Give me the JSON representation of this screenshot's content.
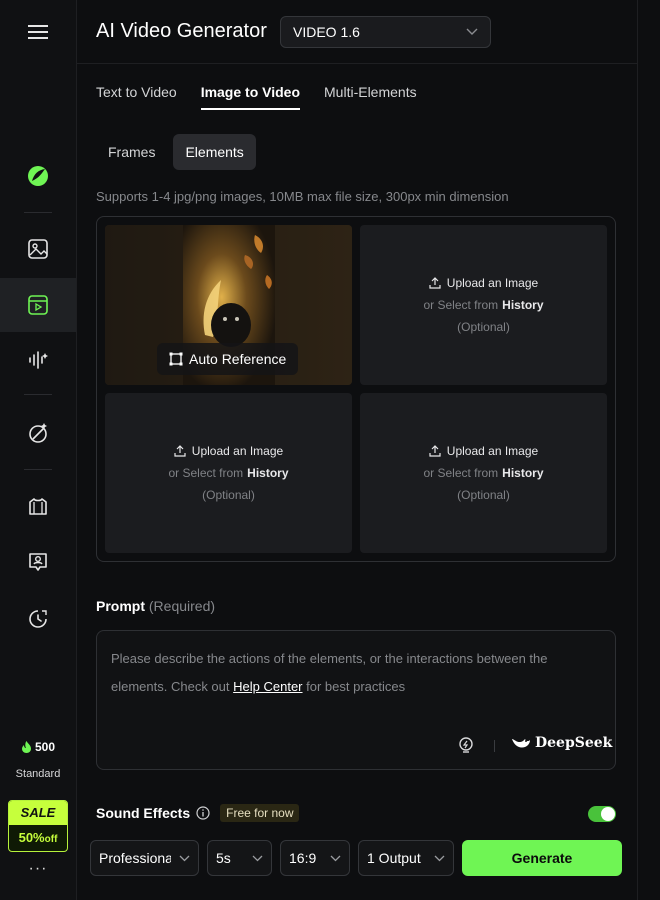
{
  "header": {
    "title": "AI Video Generator",
    "model": "VIDEO 1.6"
  },
  "tabs": [
    {
      "label": "Text to Video"
    },
    {
      "label": "Image to Video"
    },
    {
      "label": "Multi-Elements"
    }
  ],
  "subtabs": [
    {
      "label": "Frames"
    },
    {
      "label": "Elements"
    }
  ],
  "support_text": "Supports 1-4 jpg/png images, 10MB max file size, 300px min dimension",
  "upload": {
    "auto_reference": "Auto Reference",
    "upload_label": "Upload an Image",
    "select_prefix": "or Select from",
    "history_label": "History",
    "optional": "(Optional)"
  },
  "prompt": {
    "label": "Prompt",
    "required": "(Required)",
    "placeholder_part1": "Please describe the actions of the elements, or the interactions between the elements. Check out",
    "help_link": "Help Center",
    "placeholder_part2": "for best practices",
    "deepseek": "DeepSeek"
  },
  "sound": {
    "label": "Sound Effects",
    "badge": "Free for now",
    "enabled": true
  },
  "controls": {
    "mode": "Professional",
    "duration": "5s",
    "ratio": "16:9",
    "outputs": "1 Output",
    "generate": "Generate"
  },
  "sidebar": {
    "credits": "500",
    "tier": "Standard",
    "sale_top": "SALE",
    "sale_pct": "50%",
    "sale_off": "off",
    "more": "···"
  },
  "colors": {
    "accent": "#6ff554",
    "sale": "#c6ff3c"
  }
}
